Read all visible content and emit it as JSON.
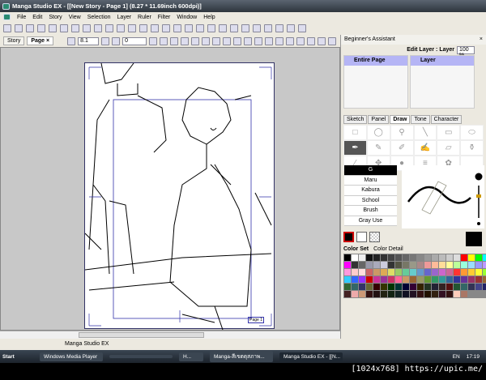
{
  "title": "Manga Studio EX - [[New Story - Page 1] (8.27 * 11.69inch 600dpi)]",
  "menu": [
    "File",
    "Edit",
    "Story",
    "View",
    "Selection",
    "Layer",
    "Ruler",
    "Filter",
    "Window",
    "Help"
  ],
  "doc_tabs": {
    "story": "Story",
    "page": "Page",
    "close": "×"
  },
  "zoom_value": "8.1",
  "rotate_value": "0",
  "page_label": "Page 1",
  "status": "Manga Studio EX",
  "panel": {
    "title": "Beginner's Assistant",
    "close": "×",
    "edit_layer": "Edit Layer : Layer",
    "opacity": "100 %",
    "page_item": "Entire Page",
    "layer_item": "Layer",
    "tabs": [
      "Sketch",
      "Panel",
      "Draw",
      "Tone",
      "Character"
    ],
    "pens": [
      "G",
      "Maru",
      "Kabura",
      "School",
      "Brush",
      "Gray Use"
    ],
    "color_tabs": [
      "Color Set",
      "Color Detail"
    ]
  },
  "palette": [
    "#000",
    "#fff",
    "#eee",
    "#111",
    "#222",
    "#333",
    "#444",
    "#555",
    "#666",
    "#777",
    "#888",
    "#999",
    "#aaa",
    "#bbb",
    "#ccc",
    "#ddd",
    "#f00",
    "#ff0",
    "#0f0",
    "#0ff",
    "#00f",
    "#f0f",
    "#333",
    "#666",
    "#99a",
    "#aab",
    "#ccd",
    "#333",
    "#554",
    "#776",
    "#998",
    "#a88",
    "#e99",
    "#fb9",
    "#fd9",
    "#ff9",
    "#bf9",
    "#9fd",
    "#9df",
    "#99f",
    "#b9f",
    "#d9f",
    "#f9d",
    "#fcc",
    "#fdd",
    "#c66",
    "#c96",
    "#da5",
    "#dd6",
    "#9c6",
    "#6c9",
    "#6cc",
    "#69c",
    "#66c",
    "#96c",
    "#c6c",
    "#c69",
    "#f33",
    "#f93",
    "#fc3",
    "#ff3",
    "#9f3",
    "#3f9",
    "#3cf",
    "#36f",
    "#93f",
    "#c00",
    "#c39",
    "#939",
    "#c36",
    "#f69",
    "#c96",
    "#963",
    "#996",
    "#693",
    "#396",
    "#399",
    "#369",
    "#339",
    "#639",
    "#936",
    "#933",
    "#963",
    "#663",
    "#363",
    "#366",
    "#336",
    "#663",
    "#300",
    "#330",
    "#030",
    "#033",
    "#003",
    "#303",
    "#320",
    "#232",
    "#223",
    "#322",
    "#511",
    "#253",
    "#366",
    "#335",
    "#448",
    "#226",
    "#414",
    "#422",
    "#eaa",
    "#c97",
    "#311",
    "#211",
    "#221",
    "#121",
    "#122",
    "#112",
    "#212",
    "#311",
    "#210",
    "#321",
    "#312",
    "#311",
    "#fcb",
    "#a76"
  ],
  "taskbar": {
    "start": "Start",
    "items": [
      "Windows Media Player",
      "",
      "H...",
      "Manga-สีเขตดุสภาพ...",
      "Manga Studio EX - [[N..."
    ],
    "lang": "EN",
    "clock": "17:19"
  },
  "watermark": "[1024x768] https://upic.me/"
}
